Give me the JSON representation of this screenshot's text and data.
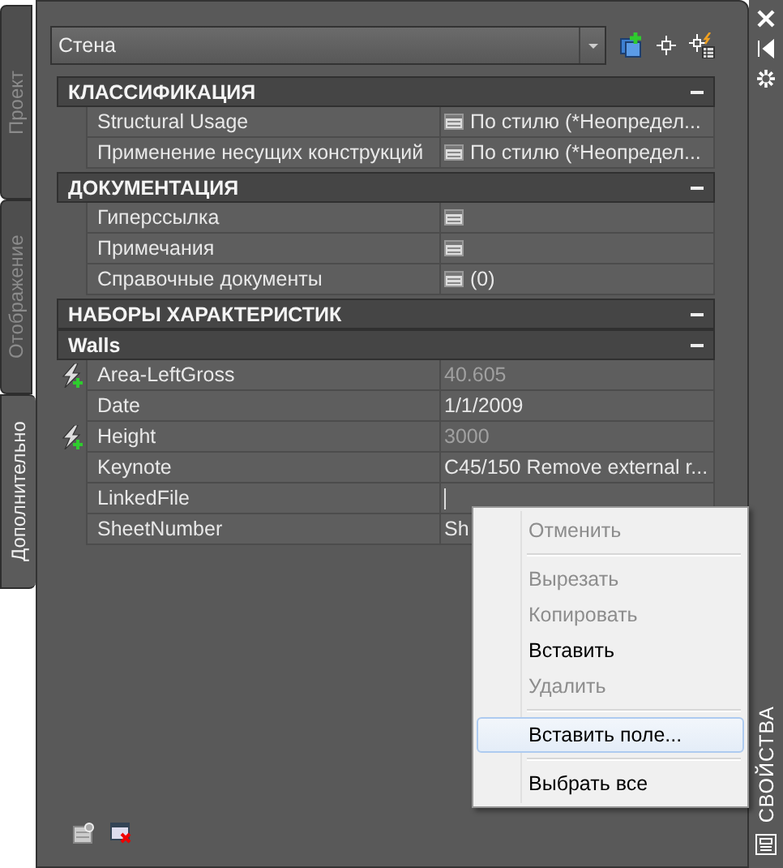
{
  "side_tabs": [
    {
      "label": "Проект",
      "selected": false
    },
    {
      "label": "Отображение",
      "selected": false
    },
    {
      "label": "Дополнительно",
      "selected": true
    }
  ],
  "style_dropdown": {
    "value": "Стена"
  },
  "categories": [
    {
      "title": "КЛАССИФИКАЦИЯ",
      "expanded": true,
      "rows": [
        {
          "kind": "list",
          "name": "Structural Usage",
          "value": "По стилю (*Неопредел..."
        },
        {
          "kind": "list",
          "name": "Применение несущих конструкций",
          "value": "По стилю (*Неопредел..."
        }
      ]
    },
    {
      "title": "ДОКУМЕНТАЦИЯ",
      "expanded": true,
      "rows": [
        {
          "kind": "list",
          "name": "Гиперссылка"
        },
        {
          "kind": "list",
          "name": "Примечания"
        },
        {
          "kind": "list",
          "name": "Справочные документы",
          "value": "(0)"
        }
      ]
    },
    {
      "title": "НАБОРЫ ХАРАКТЕРИСТИК",
      "expanded": true,
      "groups": [
        {
          "title": "Walls",
          "expanded": true,
          "rows": [
            {
              "kind": "formula",
              "name": "Area-LeftGross",
              "value": "40.605"
            },
            {
              "kind": "text",
              "name": "Date",
              "value": "1/1/2009"
            },
            {
              "kind": "formula",
              "name": "Height",
              "value": "3000"
            },
            {
              "kind": "text",
              "name": "Keynote",
              "value": "C45/150 Remove external r..."
            },
            {
              "kind": "edit",
              "name": "LinkedFile"
            },
            {
              "kind": "text",
              "name": "SheetNumber",
              "value": "Sh"
            }
          ]
        }
      ]
    }
  ],
  "palette_title": "СВОЙСТВА",
  "context_menu": [
    {
      "kind": "item",
      "label": "Отменить",
      "disabled": true,
      "highlighted": false
    },
    {
      "kind": "separator"
    },
    {
      "kind": "item",
      "label": "Вырезать",
      "disabled": true,
      "highlighted": false
    },
    {
      "kind": "item",
      "label": "Копировать",
      "disabled": true,
      "highlighted": false
    },
    {
      "kind": "item",
      "label": "Вставить",
      "disabled": false,
      "highlighted": false
    },
    {
      "kind": "item",
      "label": "Удалить",
      "disabled": true,
      "highlighted": false
    },
    {
      "kind": "separator"
    },
    {
      "kind": "item",
      "label": "Вставить поле...",
      "disabled": false,
      "highlighted": true
    },
    {
      "kind": "separator"
    },
    {
      "kind": "item",
      "label": "Выбрать все",
      "disabled": false,
      "highlighted": false
    }
  ]
}
